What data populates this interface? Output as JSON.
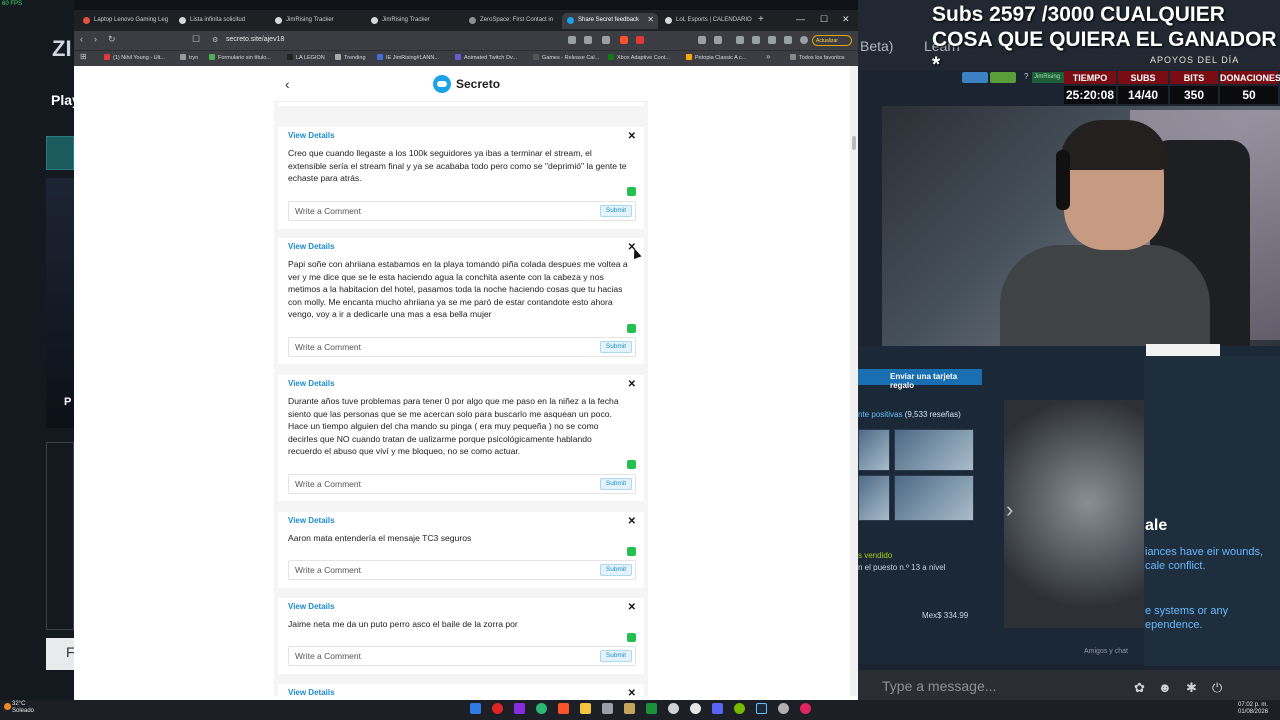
{
  "fps": "60 FPS",
  "stream": {
    "left_partial_text": "ZI",
    "left_partial_text2": "Play",
    "left_partial_p": "P",
    "left_partial_f": "F",
    "beta_text": "Beta)",
    "learn_text": "Learn",
    "overlay_title": "Subs 2597 /3000 CUALQUIER COSA QUE QUIERA EL GANADOR *",
    "apoyos_label": "APOYOS DEL DÍA",
    "twitch_question": "?",
    "twitch_user": "JimRising",
    "stats": [
      {
        "label": "TIEMPO",
        "value": "25:20:08"
      },
      {
        "label": "SUBS",
        "value": "14/40"
      },
      {
        "label": "BITS",
        "value": "350"
      },
      {
        "label": "DONACIONES",
        "value": "50"
      }
    ],
    "steam": {
      "gift_button": "Enviar una tarjeta regalo",
      "reviews_label": "nte positivas",
      "reviews_count": "(9,533 reseñas)",
      "sold_label": "s vendido",
      "rank_text": "n el puesto n.º 13 a nivel",
      "price": "Mex$ 334.99",
      "title_partial": "ale",
      "desc1": "iances have eir wounds, cale conflict.",
      "desc2": "e systems or any ependence.",
      "friends_label": "Amigos y chat"
    },
    "chat_placeholder": "Type a message..."
  },
  "taskbar": {
    "weather_temp": "32°C",
    "weather_desc": "Soleado",
    "time": "07:02 p. m.",
    "date": "01/08/2026"
  },
  "browser": {
    "tabs": [
      {
        "label": "Laptop Lenovo Gaming Leg",
        "color": "#e2533f"
      },
      {
        "label": "Lista infinita solicitud",
        "color": "#d8d8d8"
      },
      {
        "label": "JimRising Tracker",
        "color": "#d8d8d8"
      },
      {
        "label": "JimRising Tracker",
        "color": "#d8d8d8"
      },
      {
        "label": "ZeroSpace: First Contact in",
        "color": "#8f8f8f"
      },
      {
        "label": "Share Secret feedback",
        "color": "#1aa3e8"
      },
      {
        "label": "LoL Esports | CALENDARIO",
        "color": "#d8d8d8"
      }
    ],
    "url": "secreto.site/ajev18",
    "update_label": "Actualizar",
    "bookmarks": [
      {
        "label": "(1) Nihil Young - Ult...",
        "color": "#e53935"
      },
      {
        "label": "tryn",
        "color": "#999999"
      },
      {
        "label": "Formulario sin título...",
        "color": "#4caf50"
      },
      {
        "label": "LA LEGION",
        "color": "#222222"
      },
      {
        "label": "Trending",
        "color": "#aaaaaa"
      },
      {
        "label": "IE JimRising#LANN...",
        "color": "#3f6fd8"
      },
      {
        "label": "Animated Twitch Ov...",
        "color": "#6a5acd"
      },
      {
        "label": "Games - Release Cal...",
        "color": "#555555"
      },
      {
        "label": "Xbox Adaptive Cont...",
        "color": "#107c10"
      },
      {
        "label": "Petopia Classic A c...",
        "color": "#ffaa00"
      },
      {
        "label": "Todos los favoritos",
        "color": "#888888"
      }
    ]
  },
  "app": {
    "brand": "Secreto",
    "back_icon": "‹",
    "view_details_label": "View Details",
    "comment_placeholder": "Write a Comment",
    "submit_label": "Submit",
    "accent_color": "#1d8ccd",
    "whatsapp_color": "#25c150",
    "messages": [
      {
        "text": "Creo que cuando llegaste a los 100k seguidores ya ibas a terminar el stream, el extensible sería el stream final y ya se acababa todo pero como se \"deprimió\" la gente te echaste para atrás."
      },
      {
        "text": "Papi soñe con ahriiana estabamos en la playa tomando piña colada despues me voltea a ver y me dice que se le esta haciendo agua la conchita asente con la cabeza y nos metimos a la habitacion del hotel, pasamos toda la noche haciendo cosas que tu hacias con molly. Me encanta mucho ahriiana ya se me paró de estar contandote esto ahora vengo, voy a ir a dedicarle una mas a esa bella mujer"
      },
      {
        "text": "Durante años tuve problemas para tener 0 por algo que me paso en la niñez a la fecha siento que las personas que se me acercan solo para buscarlo me asquean un poco. Hace un tiempo alguien del cha mando su pinga ( era muy pequeña ) no se como decirles que NO cuando tratan de ualizarme porque psicológicamente hablando recuerdo el abuso que viví y me bloqueo, no se como actuar."
      },
      {
        "text": "Aaron mata entendería el mensaje TC3 seguros"
      },
      {
        "text": "Jaime neta me da un puto perro asco el baile de la zorra por"
      }
    ]
  }
}
